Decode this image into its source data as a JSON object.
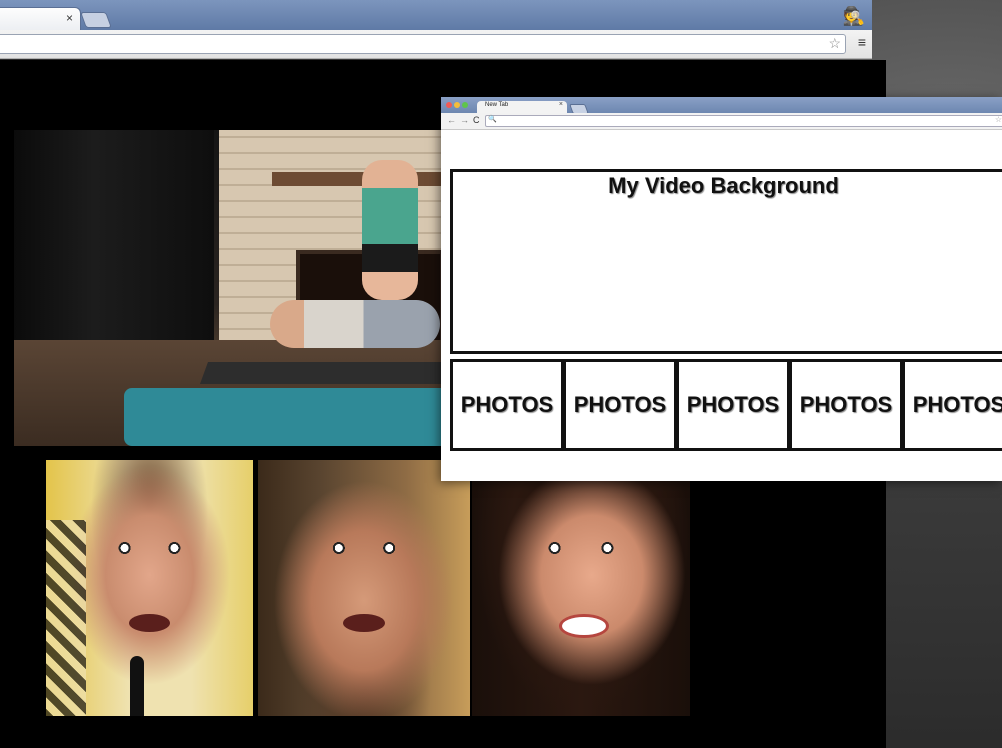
{
  "back_browser": {
    "tab_close_symbol": "×",
    "star_icon": "☆",
    "menu_icon": "≡"
  },
  "front_browser": {
    "tab_title": "New Tab",
    "tab_close_symbol": "×",
    "nav": {
      "back": "←",
      "forward": "→",
      "reload": "C"
    },
    "search_symbol": "🔍",
    "star_icon": "☆"
  },
  "mockup": {
    "hero_title": "My Video Background",
    "photos": [
      "PHOTOS",
      "PHOTOS",
      "PHOTOS",
      "PHOTOS",
      "PHOTOS"
    ]
  }
}
